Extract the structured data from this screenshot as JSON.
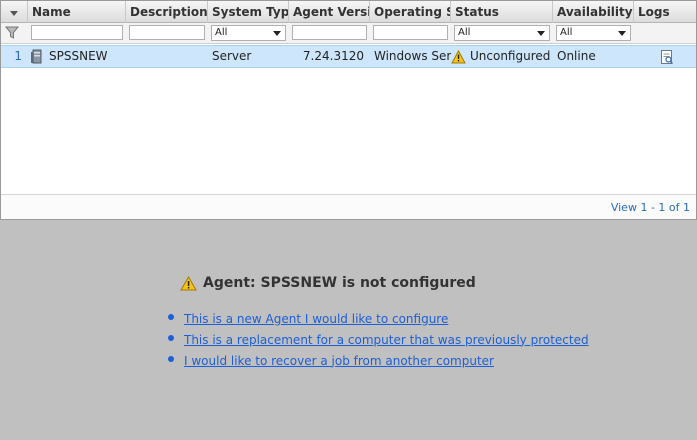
{
  "grid": {
    "columns": [
      "Name",
      "Description",
      "System Typ",
      "Agent Versi",
      "Operating S",
      "Status",
      "Availability",
      "Logs"
    ],
    "filter_options": {
      "system_type": "All",
      "status": "All",
      "availability": "All"
    },
    "row": {
      "index": "1",
      "name": "SPSSNEW",
      "system_type": "Server",
      "agent_version": "7.24.3120",
      "operating_system": "Windows Serv",
      "status": "Unconfigured",
      "availability": "Online"
    },
    "pager": "View 1 - 1 of 1"
  },
  "message": {
    "title": "Agent: SPSSNEW is not configured",
    "options": [
      " This is a new Agent I would like to configure",
      " This is a replacement for a computer that was previously protected",
      " I would like to recover a job from another computer"
    ]
  },
  "icons": {
    "filter": "filter-icon",
    "server": "server-icon",
    "warning": "warning-icon",
    "log": "log-document-icon"
  }
}
